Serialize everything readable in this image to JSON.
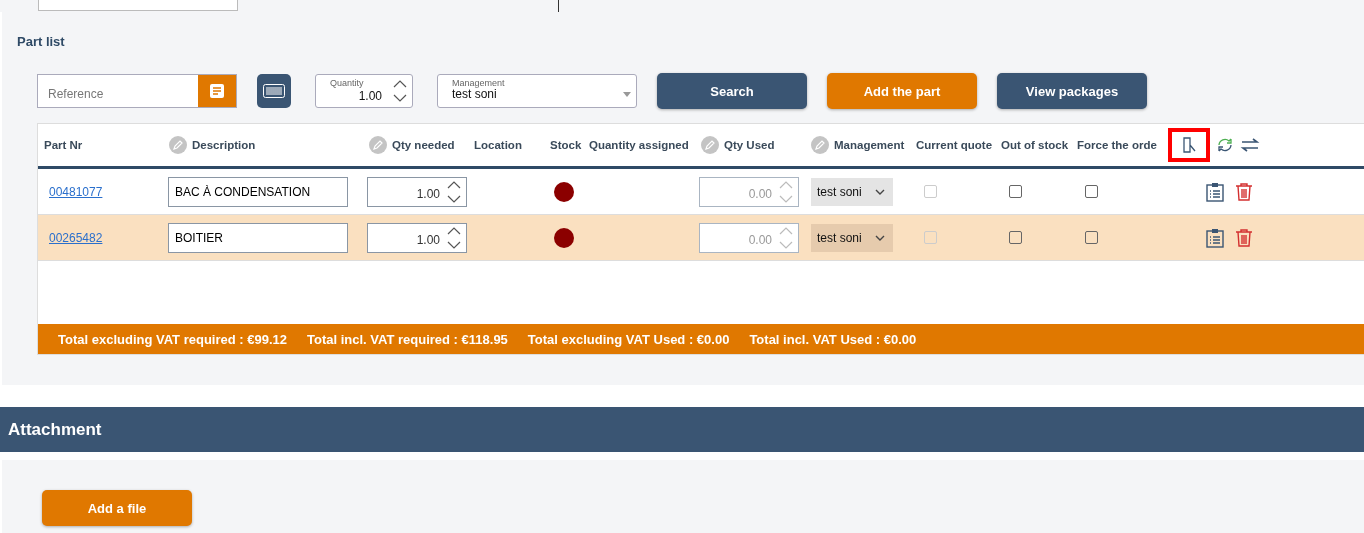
{
  "part_list": {
    "title": "Part list",
    "reference": {
      "placeholder": "Reference"
    },
    "quantity": {
      "label": "Quantity",
      "value": "1.00"
    },
    "management": {
      "label": "Management",
      "value": "test soni"
    },
    "buttons": [
      {
        "label": "Search",
        "kind": "dark"
      },
      {
        "label": "Add the part",
        "kind": "orange"
      },
      {
        "label": "View packages",
        "kind": "dark"
      }
    ],
    "columns": [
      {
        "label": "Part Nr",
        "kind": "plain"
      },
      {
        "label": "Description",
        "kind": "editable"
      },
      {
        "label": "Qty needed",
        "kind": "editable"
      },
      {
        "label": "Location",
        "kind": "plain"
      },
      {
        "label": "Stock",
        "kind": "plain"
      },
      {
        "label": "Quantity assigned",
        "kind": "plain"
      },
      {
        "label": "Qty Used",
        "kind": "editable"
      },
      {
        "label": "Management",
        "kind": "editable"
      },
      {
        "label": "Current quote",
        "kind": "plain"
      },
      {
        "label": "Out of stock",
        "kind": "plain"
      },
      {
        "label": "Force the orde",
        "kind": "plain"
      }
    ],
    "rows": [
      {
        "part_nr": "00481077",
        "description": "BAC À CONDENSATION",
        "qty_needed": "1.00",
        "stock": {
          "color": "#8b0000"
        },
        "qty_used": "0.00",
        "management": "test soni",
        "current_quote": {
          "checked": false,
          "disabled": true
        },
        "out_of_stock": {
          "checked": false,
          "disabled": false
        },
        "force_order": {
          "checked": false,
          "disabled": false
        },
        "selected": false
      },
      {
        "part_nr": "00265482",
        "description": "BOITIER",
        "qty_needed": "1.00",
        "stock": {
          "color": "#8b0000"
        },
        "qty_used": "0.00",
        "management": "test soni",
        "current_quote": {
          "checked": false,
          "disabled": true
        },
        "out_of_stock": {
          "checked": false,
          "disabled": false
        },
        "force_order": {
          "checked": false,
          "disabled": false
        },
        "selected": true
      }
    ],
    "totals": [
      "Total excluding VAT required : €99.12",
      "Total incl. VAT required : €118.95",
      "Total excluding VAT Used : €0.00",
      "Total incl. VAT Used : €0.00"
    ]
  },
  "attachment": {
    "title": "Attachment",
    "button": "Add a file"
  }
}
